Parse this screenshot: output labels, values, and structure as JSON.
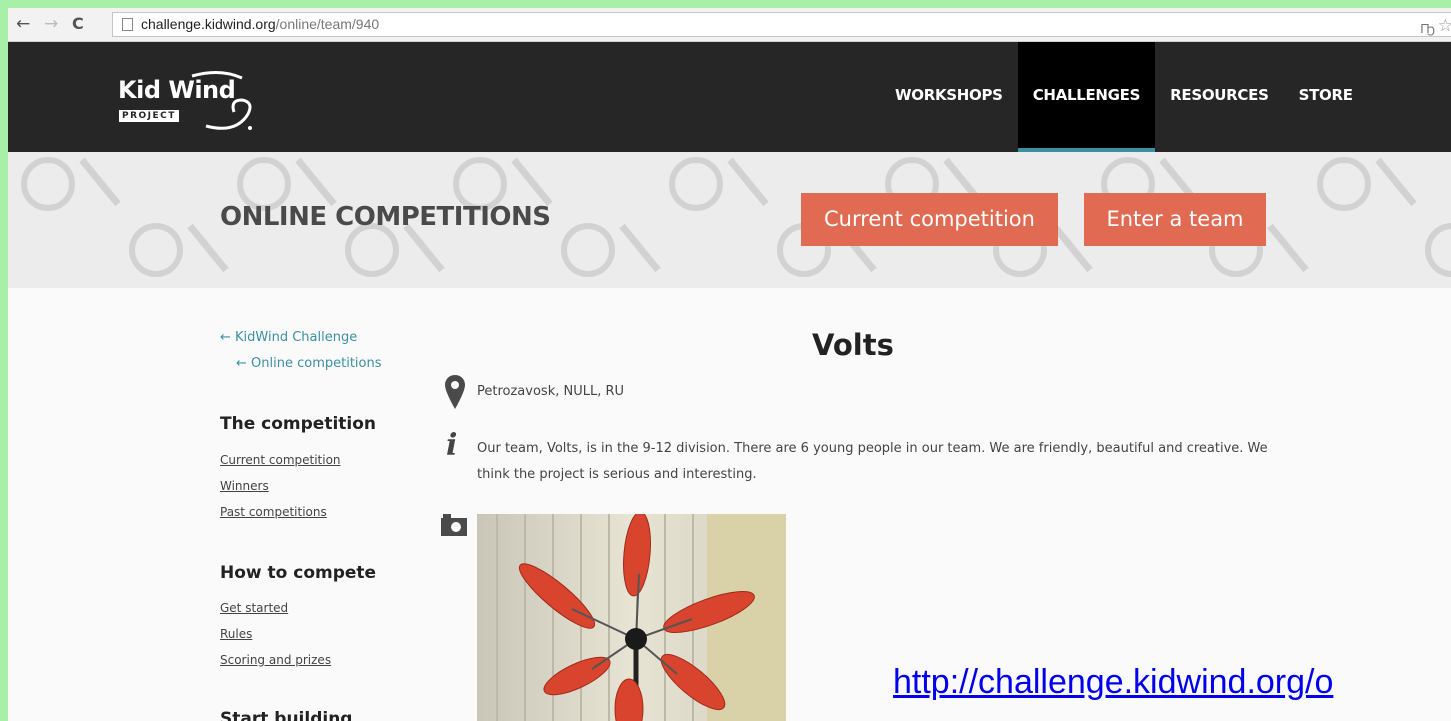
{
  "browser": {
    "back_icon": "←",
    "forward_icon": "→",
    "reload_icon": "C",
    "url_domain": "challenge.kidwind.org",
    "url_path": "/online/team/940",
    "extension_icon": "Ҧ",
    "star_icon": "☆"
  },
  "header": {
    "logo_text": "Kid Wind",
    "logo_subtext": "PROJECT",
    "menu": [
      {
        "label": "WORKSHOPS"
      },
      {
        "label": "CHALLENGES"
      },
      {
        "label": "RESOURCES"
      },
      {
        "label": "STORE"
      }
    ]
  },
  "banner": {
    "title": "ONLINE COMPETITIONS",
    "current_competition_button": "Current competition",
    "enter_team_button": "Enter a team"
  },
  "sidebar": {
    "crumb_kidwind": "← KidWind Challenge",
    "crumb_online": "← Online competitions",
    "sections": [
      {
        "heading": "The competition",
        "links": [
          "Current competition",
          "Winners",
          "Past competitions"
        ]
      },
      {
        "heading": "How to compete",
        "links": [
          "Get started",
          "Rules",
          "Scoring and prizes"
        ]
      },
      {
        "heading": "Start building"
      }
    ]
  },
  "team": {
    "name": "Volts",
    "location": "Petrozavosk, NULL, RU",
    "description": "Our team, Volts, is in the 9-12 division. There are 6 young people in our team. We are friendly, beautiful and creative. We think the project is serious and interesting."
  },
  "overlay": {
    "link_text": "http://challenge.kidwind.org/o"
  },
  "colors": {
    "accent": "#e06a52",
    "link": "#3d8fa3",
    "header_bg": "#262626",
    "active_underline": "#3d8fa3"
  }
}
